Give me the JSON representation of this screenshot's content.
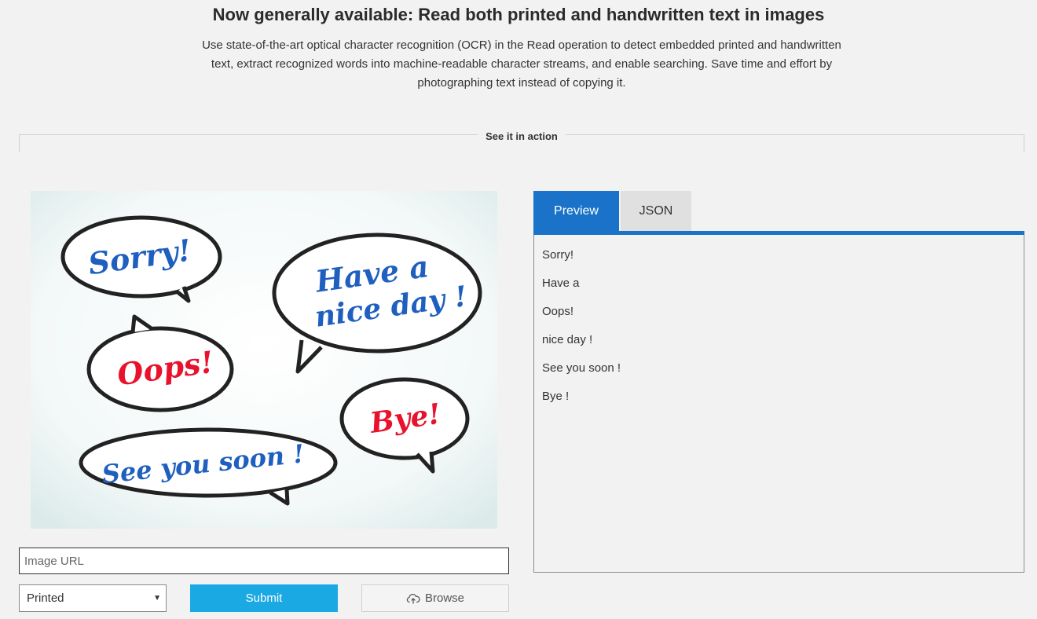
{
  "header": {
    "title": "Now generally available: Read both printed and handwritten text in images",
    "description": "Use state-of-the-art optical character recognition (OCR) in the Read operation to detect embedded printed and handwritten text, extract recognized words into machine-readable character streams, and enable searching. Save time and effort by photographing text instead of copying it."
  },
  "section": {
    "label": "See it in action"
  },
  "sample_image": {
    "bubbles": [
      {
        "text": "Sorry!",
        "color": "#1f5fbf"
      },
      {
        "text": "Have a",
        "color": "#1f5fbf"
      },
      {
        "text": "nice day !",
        "color": "#1f5fbf"
      },
      {
        "text": "Oops!",
        "color": "#e8122d"
      },
      {
        "text": "Bye!",
        "color": "#e8122d"
      },
      {
        "text": "See you soon !",
        "color": "#1f5fbf"
      }
    ]
  },
  "form": {
    "url_placeholder": "Image URL",
    "mode_selected": "Printed",
    "submit_label": "Submit",
    "browse_label": "Browse",
    "browse_icon": "cloud-upload-icon"
  },
  "tabs": [
    {
      "label": "Preview",
      "active": true
    },
    {
      "label": "JSON",
      "active": false
    }
  ],
  "results": [
    "Sorry!",
    "Have a",
    "Oops!",
    "nice day !",
    "See you soon !",
    "Bye !"
  ],
  "colors": {
    "accent": "#1a73c8",
    "submit": "#1ba9e3",
    "red_text": "#e8122d",
    "blue_text": "#1f5fbf"
  }
}
